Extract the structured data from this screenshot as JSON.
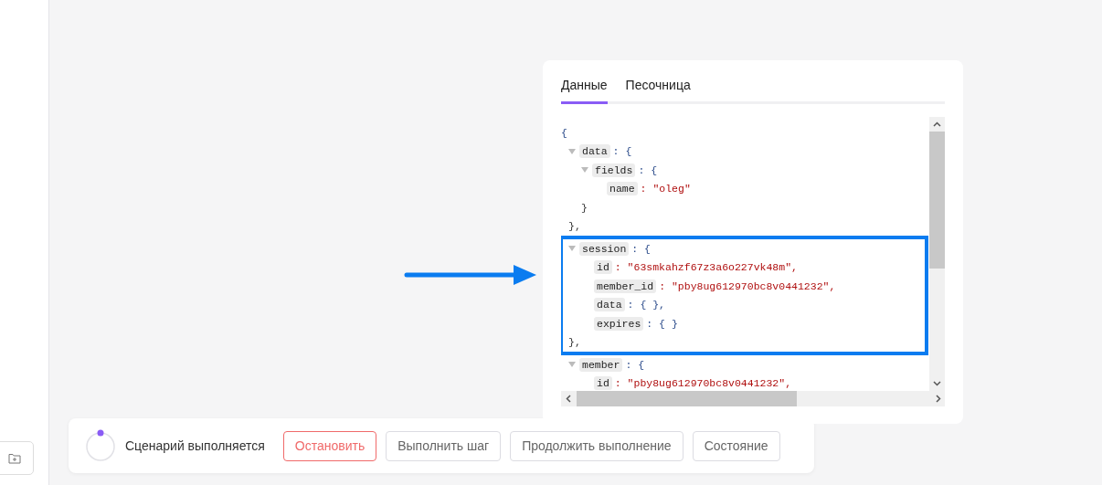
{
  "panel": {
    "tabs": [
      {
        "label": "Данные",
        "selected": true
      },
      {
        "label": "Песочница",
        "selected": false
      }
    ],
    "code": {
      "open": "{",
      "nodes": [
        {
          "key": "data",
          "open": ": {",
          "close": "},",
          "expanded": true,
          "highlighted": false,
          "children": [
            {
              "key": "fields",
              "open": ": {",
              "close": "}",
              "expanded": true,
              "children": [
                {
                  "key": "name",
                  "value": ": \"oleg\"",
                  "kind": "string"
                }
              ]
            }
          ]
        },
        {
          "key": "session",
          "open": ": {",
          "close": "},",
          "expanded": true,
          "highlighted": true,
          "children": [
            {
              "key": "id",
              "value": ": \"63smkahzf67z3a6o227vk48m\",",
              "kind": "string"
            },
            {
              "key": "member_id",
              "value": ": \"pby8ug612970bc8v0441232\",",
              "kind": "string"
            },
            {
              "key": "data",
              "value": ": { },",
              "kind": "object"
            },
            {
              "key": "expires",
              "value": ": { }",
              "kind": "object"
            }
          ]
        },
        {
          "key": "member",
          "open": ": {",
          "expanded": true,
          "highlighted": false,
          "children": [
            {
              "key": "id",
              "value": ": \"pby8ug612970bc8v0441232\",",
              "kind": "string"
            }
          ]
        }
      ]
    }
  },
  "run_bar": {
    "status": "Сценарий выполняется",
    "buttons": [
      {
        "label": "Остановить",
        "kind": "danger"
      },
      {
        "label": "Выполнить шаг",
        "kind": "plain"
      },
      {
        "label": "Продолжить выполнение",
        "kind": "plain"
      },
      {
        "label": "Состояние",
        "kind": "plain"
      }
    ]
  }
}
